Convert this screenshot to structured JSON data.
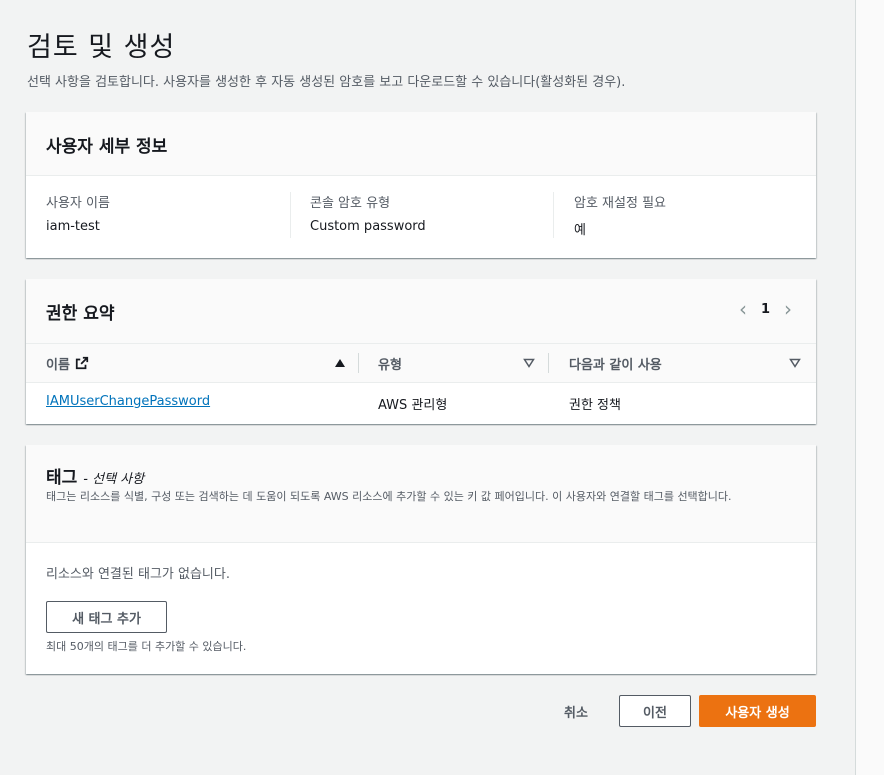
{
  "page": {
    "title": "검토 및 생성",
    "description": "선택 사항을 검토합니다. 사용자를 생성한 후 자동 생성된 암호를 보고 다운로드할 수 있습니다(활성화된 경우)."
  },
  "user_details": {
    "title": "사용자 세부 정보",
    "fields": [
      {
        "label": "사용자 이름",
        "value": "iam-test"
      },
      {
        "label": "콘솔 암호 유형",
        "value": "Custom password"
      },
      {
        "label": "암호 재설정 필요",
        "value": "예"
      }
    ]
  },
  "permissions": {
    "title": "권한 요약",
    "page": "1",
    "columns": [
      "이름",
      "유형",
      "다음과 같이 사용"
    ],
    "rows": [
      {
        "name": "IAMUserChangePassword",
        "type": "AWS 관리형",
        "used_as": "권한 정책"
      }
    ],
    "icons": {
      "external_link": "external-link-icon",
      "sort_asc": "sort-ascending-icon",
      "sort_desc": "sort-descending-icon"
    }
  },
  "tags": {
    "title": "태그",
    "optional": "- 선택 사항",
    "description": "태그는 리소스를 식별, 구성 또는 검색하는 데 도움이 되도록 AWS 리소스에 추가할 수 있는 키 값 페어입니다. 이 사용자와 연결할 태그를 선택합니다.",
    "empty": "리소스와 연결된 태그가 없습니다.",
    "add_button": "새 태그 추가",
    "hint": "최대 50개의 태그를 더 추가할 수 있습니다."
  },
  "footer": {
    "cancel": "취소",
    "previous": "이전",
    "create": "사용자 생성"
  },
  "colors": {
    "accent": "#ec7211",
    "link": "#0073bb"
  }
}
